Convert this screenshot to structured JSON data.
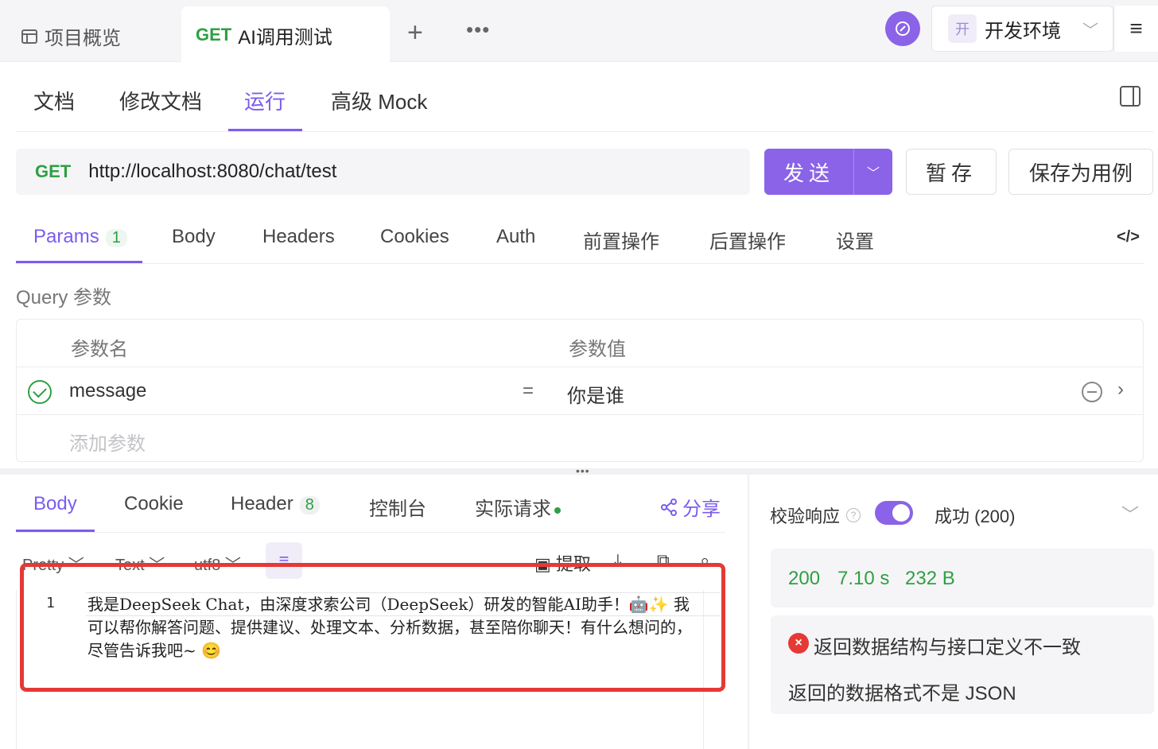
{
  "topbar": {
    "overview_tab": "项目概览",
    "active_tab": {
      "method": "GET",
      "title": "AI调用测试"
    },
    "plus": "+",
    "more": "•••",
    "env": {
      "badge": "开",
      "label": "开发环境"
    }
  },
  "subnav": {
    "items": [
      "文档",
      "修改文档",
      "运行",
      "高级 Mock"
    ],
    "active_index": 2
  },
  "url_bar": {
    "method": "GET",
    "url": "http://localhost:8080/chat/test",
    "send_label": "发送",
    "save_label": "暂存",
    "save_as_case_label": "保存为用例"
  },
  "request_tabs": {
    "params_label": "Params",
    "params_count": "1",
    "items": [
      "Body",
      "Headers",
      "Cookies",
      "Auth",
      "前置操作",
      "后置操作",
      "设置"
    ],
    "code_icon": "</>"
  },
  "query": {
    "section_label": "Query 参数",
    "col_name": "参数名",
    "col_value": "参数值",
    "rows": [
      {
        "name": "message",
        "eq": "=",
        "value": "你是谁",
        "enabled": true
      }
    ],
    "add_placeholder": "添加参数"
  },
  "response": {
    "tabs": {
      "body": "Body",
      "cookie": "Cookie",
      "header": "Header",
      "header_count": "8",
      "console": "控制台",
      "actual_request": "实际请求"
    },
    "share_label": "分享",
    "format": {
      "pretty": "Pretty",
      "text": "Text",
      "encoding": "utf8"
    },
    "extract_label": "提取",
    "line_number": "1",
    "body_text": "我是DeepSeek Chat，由深度求索公司（DeepSeek）研发的智能AI助手！🤖✨ 我可以帮你解答问题、提供建议、处理文本、分析数据，甚至陪你聊天！有什么想问的，尽管告诉我吧~ 😊"
  },
  "validation": {
    "label": "校验响应",
    "enabled": true,
    "status": "成功 (200)",
    "metrics": {
      "code": "200",
      "time": "7.10 s",
      "size": "232 B"
    },
    "error_title": "返回数据结构与接口定义不一致",
    "error_desc": "返回的数据格式不是 JSON"
  },
  "colors": {
    "accent": "#8a63e8",
    "success": "#2ea043",
    "error": "#e53935"
  }
}
